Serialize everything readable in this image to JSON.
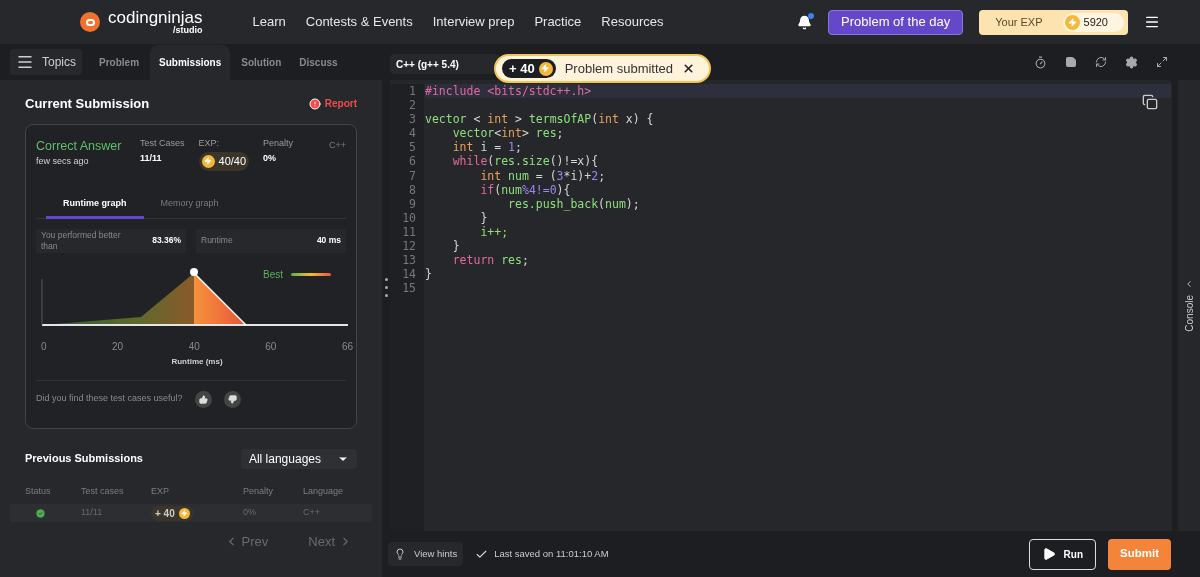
{
  "nav": {
    "logo": {
      "name": "codingninjas",
      "sub": "/studio"
    },
    "links": [
      "Learn",
      "Contests & Events",
      "Interview prep",
      "Practice",
      "Resources"
    ],
    "notification": {
      "unread": true
    },
    "potd": "Problem of the day",
    "exp": {
      "label": "Your EXP",
      "value": "5920"
    }
  },
  "left": {
    "topics": "Topics",
    "tabs": [
      {
        "label": "Problem",
        "selected": false
      },
      {
        "label": "Submissions",
        "selected": true
      },
      {
        "label": "Solution",
        "selected": false
      },
      {
        "label": "Discuss",
        "selected": false
      }
    ],
    "current": {
      "title": "Current Submission",
      "report": "Report",
      "status": "Correct Answer",
      "time": "few secs ago",
      "language": "C++",
      "stats": [
        {
          "kind": "text",
          "label": "Test Cases",
          "value": "11/11"
        },
        {
          "kind": "exp",
          "label": "EXP:",
          "value": "40/40"
        },
        {
          "kind": "text",
          "label": "Penalty",
          "value": "0%"
        }
      ],
      "graph_tabs": [
        {
          "label": "Runtime graph",
          "selected": true
        },
        {
          "label": "Memory graph",
          "selected": false
        }
      ],
      "metrics": [
        {
          "label": "You performed better than",
          "value": "83.36%"
        },
        {
          "label": "Runtime",
          "value": "40 ms"
        }
      ],
      "graph": {
        "legend": "Best",
        "x_ticks": [
          "0",
          "20",
          "40",
          "60",
          "66"
        ],
        "axis_label": "Runtime (ms)"
      },
      "feedback": "Did you find these test cases useful?"
    },
    "previous": {
      "title": "Previous Submissions",
      "filter": "All languages",
      "columns": [
        "Status",
        "Test cases",
        "EXP",
        "Penalty",
        "Language"
      ],
      "rows": [
        {
          "passed": true,
          "test_cases": "11/11",
          "exp": "+ 40",
          "penalty": "0%",
          "language": "C++"
        }
      ]
    },
    "pagination": {
      "prev": "Prev",
      "next": "Next"
    }
  },
  "editor": {
    "language": "C++ (g++ 5.4)",
    "toast": {
      "exp": "+ 40",
      "text": "Problem submitted"
    },
    "console": "Console",
    "lines": [
      {
        "number": "1",
        "tokens": [
          {
            "t": "#include <bits/stdc++.h>",
            "kind": "keyword"
          }
        ]
      },
      {
        "number": "2"
      },
      {
        "number": "3",
        "tokens": [
          {
            "t": "vector",
            "kind": "function"
          },
          {
            "t": " < ",
            "kind": "plain"
          },
          {
            "t": "int",
            "kind": "type"
          },
          {
            "t": " > ",
            "kind": "plain"
          },
          {
            "t": "termsOfAP",
            "kind": "function"
          },
          {
            "t": "(",
            "kind": "plain"
          },
          {
            "t": "int",
            "kind": "type"
          },
          {
            "t": " x) {",
            "kind": "plain"
          }
        ]
      },
      {
        "number": "4",
        "tokens": [
          {
            "t": "    vector",
            "kind": "function"
          },
          {
            "t": "<",
            "kind": "plain"
          },
          {
            "t": "int",
            "kind": "type"
          },
          {
            "t": "> ",
            "kind": "plain"
          },
          {
            "t": "res",
            "kind": "function"
          },
          {
            "t": ";",
            "kind": "plain"
          }
        ]
      },
      {
        "number": "5",
        "tokens": [
          {
            "t": "    int",
            "kind": "type"
          },
          {
            "t": " i = ",
            "kind": "plain"
          },
          {
            "t": "1",
            "kind": "number"
          },
          {
            "t": ";",
            "kind": "plain"
          }
        ]
      },
      {
        "number": "6",
        "tokens": [
          {
            "t": "    while",
            "kind": "keyword"
          },
          {
            "t": "(",
            "kind": "plain"
          },
          {
            "t": "res.size",
            "kind": "function"
          },
          {
            "t": "()!=x){",
            "kind": "plain"
          }
        ]
      },
      {
        "number": "7",
        "tokens": [
          {
            "t": "        int ",
            "kind": "type"
          },
          {
            "t": "num",
            "kind": "function"
          },
          {
            "t": " = (",
            "kind": "plain"
          },
          {
            "t": "3",
            "kind": "number"
          },
          {
            "t": "*i)+",
            "kind": "plain"
          },
          {
            "t": "2",
            "kind": "number"
          },
          {
            "t": ";",
            "kind": "plain"
          }
        ]
      },
      {
        "number": "8",
        "tokens": [
          {
            "t": "        if",
            "kind": "keyword"
          },
          {
            "t": "(",
            "kind": "plain"
          },
          {
            "t": "num",
            "kind": "function"
          },
          {
            "t": "%4!=0",
            "kind": "number"
          },
          {
            "t": "){",
            "kind": "plain"
          }
        ]
      },
      {
        "number": "9",
        "tokens": [
          {
            "t": "            res.push_back",
            "kind": "function"
          },
          {
            "t": "(",
            "kind": "plain"
          },
          {
            "t": "num",
            "kind": "function"
          },
          {
            "t": ");",
            "kind": "plain"
          }
        ]
      },
      {
        "number": "10",
        "tokens": [
          {
            "t": "        }",
            "kind": "plain"
          }
        ]
      },
      {
        "number": "11",
        "tokens": [
          {
            "t": "        i++;",
            "kind": "function"
          }
        ]
      },
      {
        "number": "12",
        "tokens": [
          {
            "t": "    }",
            "kind": "plain"
          }
        ]
      },
      {
        "number": "13",
        "tokens": [
          {
            "t": "    return ",
            "kind": "keyword"
          },
          {
            "t": "res",
            "kind": "function"
          },
          {
            "t": ";",
            "kind": "plain"
          }
        ]
      },
      {
        "number": "14",
        "tokens": [
          {
            "t": "}",
            "kind": "plain"
          }
        ]
      },
      {
        "number": "15"
      }
    ]
  },
  "footer": {
    "hints": "View hints",
    "saved": "Last saved on 11:01:10 AM",
    "run": "Run",
    "submit": "Submit"
  }
}
